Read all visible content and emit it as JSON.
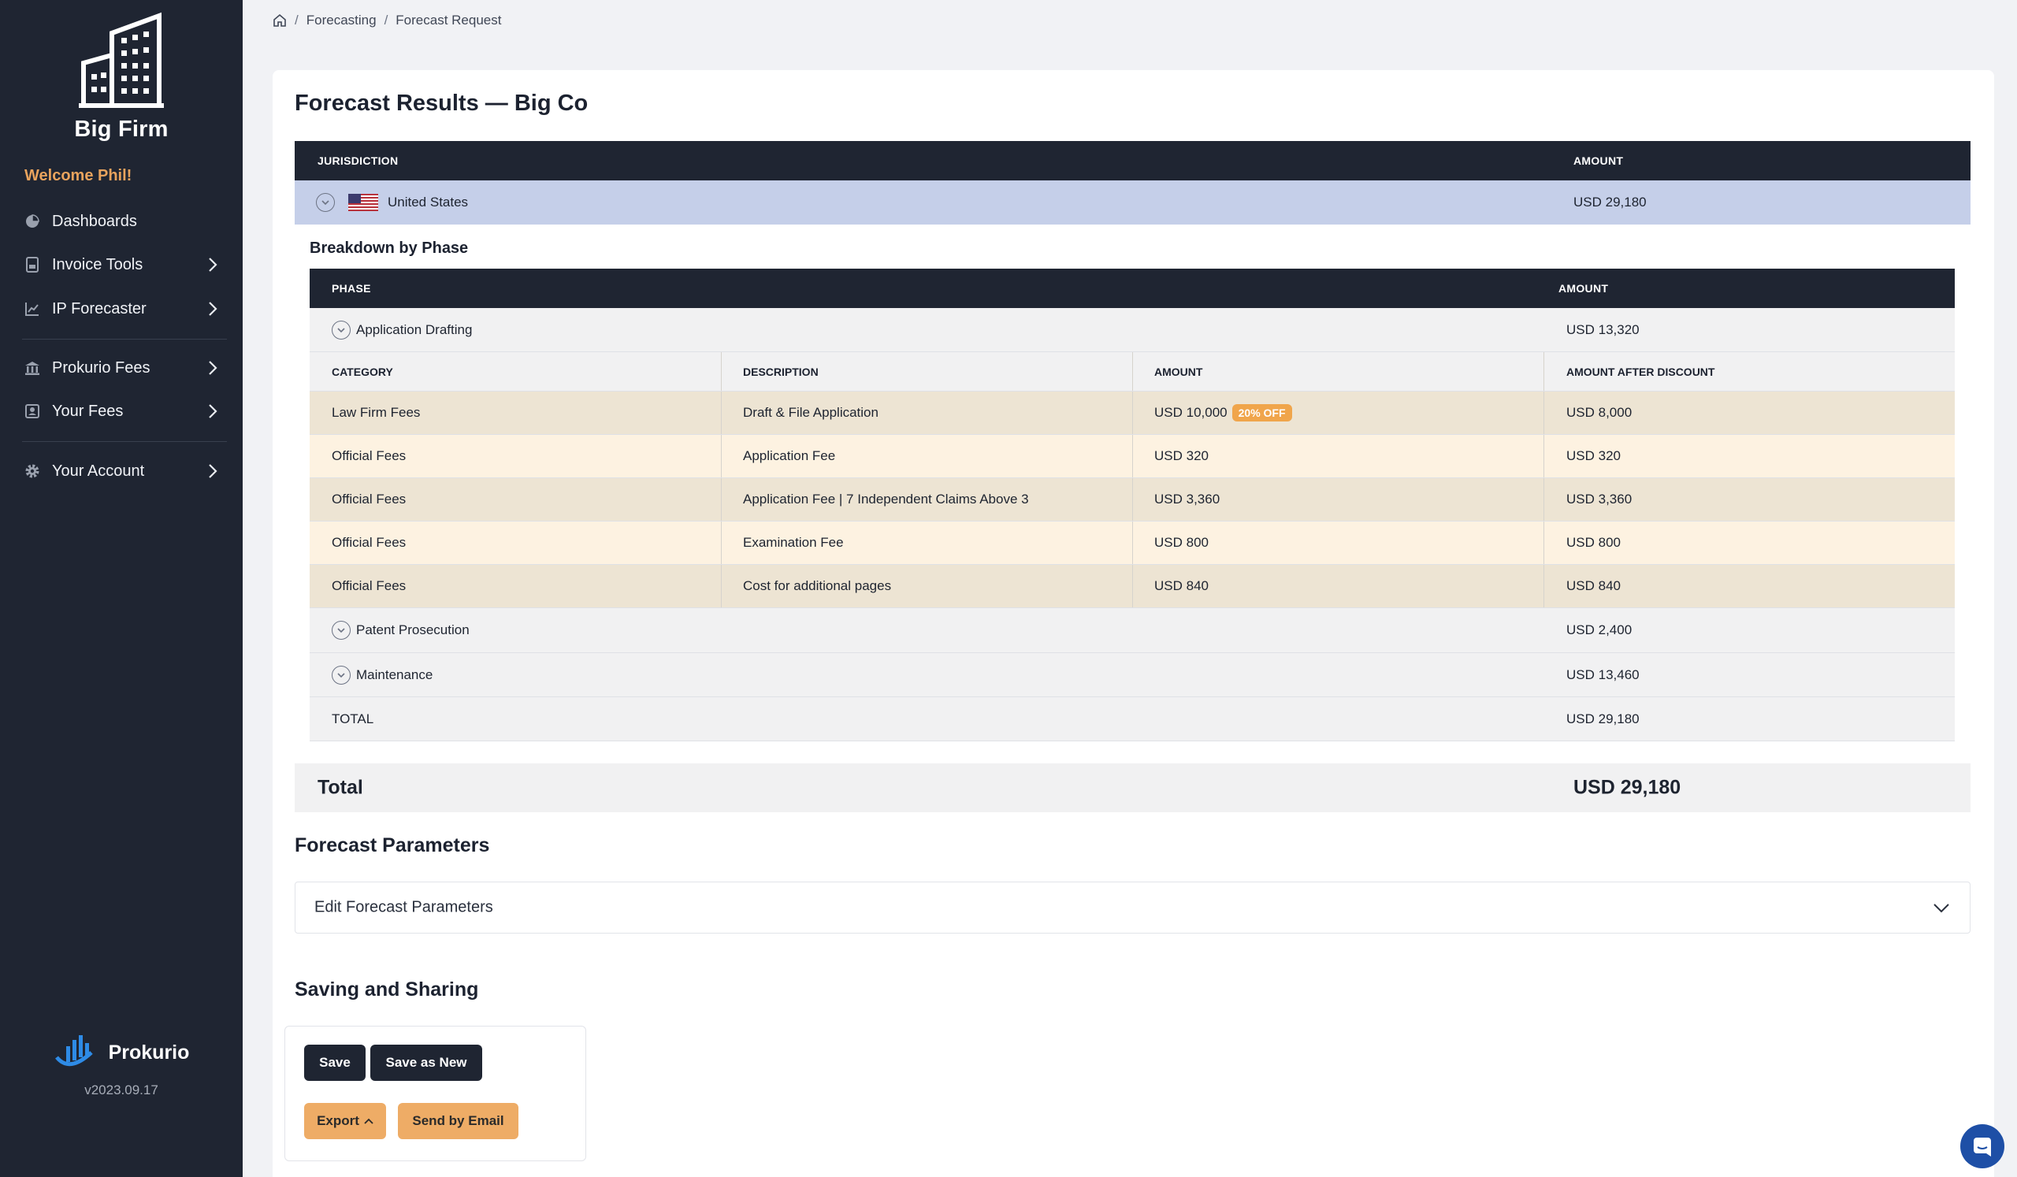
{
  "sidebar": {
    "brand": "Big Firm",
    "welcome": "Welcome Phil!",
    "items": [
      {
        "label": "Dashboards",
        "icon": "pie-chart-icon"
      },
      {
        "label": "Invoice Tools",
        "icon": "invoice-icon"
      },
      {
        "label": "IP Forecaster",
        "icon": "line-chart-icon"
      },
      {
        "label": "Prokurio Fees",
        "icon": "bank-icon"
      },
      {
        "label": "Your Fees",
        "icon": "user-card-icon"
      },
      {
        "label": "Your Account",
        "icon": "gear-icon"
      }
    ],
    "footer_brand": "Prokurio",
    "version": "v2023.09.17"
  },
  "breadcrumb": {
    "items": [
      "Forecasting",
      "Forecast Request"
    ]
  },
  "page_title": "Forecast Results — Big Co",
  "jurisdiction_table": {
    "headers": {
      "jurisdiction": "JURISDICTION",
      "amount": "AMOUNT"
    },
    "row": {
      "country": "United States",
      "amount": "USD 29,180"
    }
  },
  "breakdown": {
    "title": "Breakdown by Phase",
    "headers": {
      "phase": "PHASE",
      "amount": "AMOUNT"
    },
    "phases": [
      {
        "name": "Application Drafting",
        "amount": "USD 13,320"
      },
      {
        "name": "Patent Prosecution",
        "amount": "USD 2,400"
      },
      {
        "name": "Maintenance",
        "amount": "USD 13,460"
      }
    ],
    "fee_headers": {
      "category": "CATEGORY",
      "description": "DESCRIPTION",
      "amount": "AMOUNT",
      "after": "AMOUNT AFTER DISCOUNT"
    },
    "fees": [
      {
        "category": "Law Firm Fees",
        "description": "Draft & File Application",
        "amount": "USD 10,000",
        "badge": "20% OFF",
        "after": "USD 8,000"
      },
      {
        "category": "Official Fees",
        "description": "Application Fee",
        "amount": "USD 320",
        "after": "USD 320"
      },
      {
        "category": "Official Fees",
        "description": "Application Fee | 7 Independent Claims Above 3",
        "amount": "USD 3,360",
        "after": "USD 3,360"
      },
      {
        "category": "Official Fees",
        "description": "Examination Fee",
        "amount": "USD 800",
        "after": "USD 800"
      },
      {
        "category": "Official Fees",
        "description": "Cost for additional pages",
        "amount": "USD 840",
        "after": "USD 840"
      }
    ],
    "total_label": "TOTAL",
    "total_amount": "USD 29,180"
  },
  "grand_total": {
    "label": "Total",
    "amount": "USD 29,180"
  },
  "forecast_parameters": {
    "title": "Forecast Parameters",
    "accordion_label": "Edit Forecast Parameters"
  },
  "saving": {
    "title": "Saving and Sharing",
    "save": "Save",
    "save_as_new": "Save as New",
    "export": "Export",
    "send_email": "Send by Email"
  },
  "colors": {
    "sidebar": "#1f2532",
    "accent": "#e8a35d",
    "highlight_row": "#c5cfe9",
    "badge": "#f0a54b"
  }
}
